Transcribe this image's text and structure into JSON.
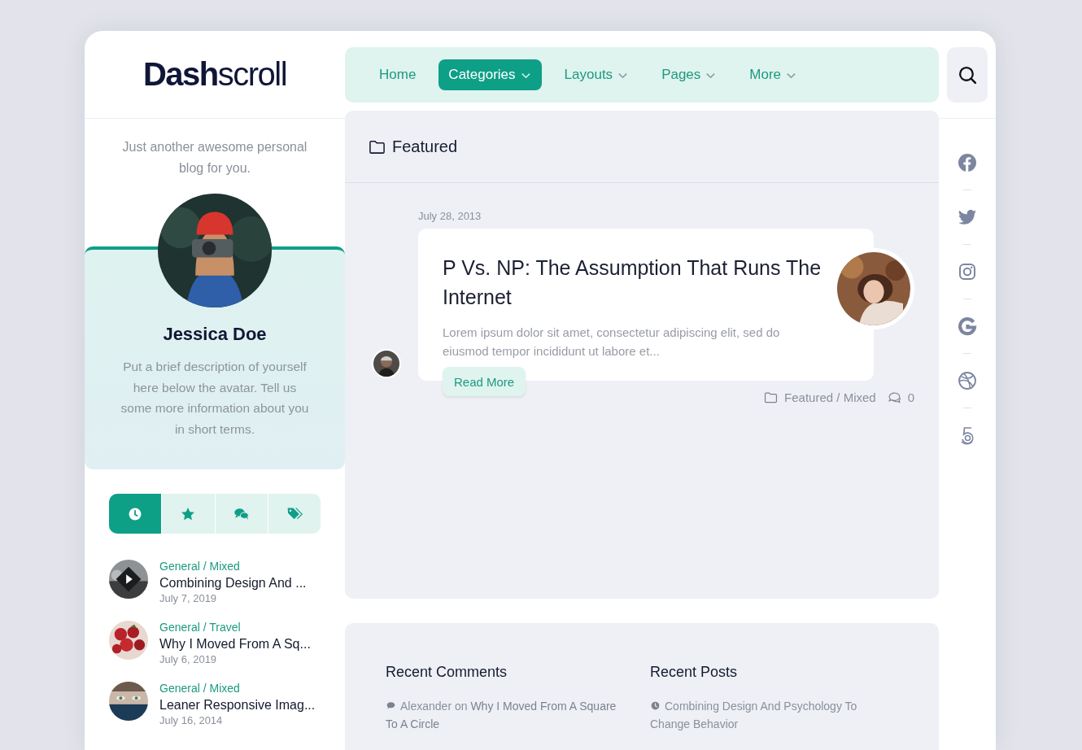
{
  "logo": "**Dash**scroll",
  "nav": {
    "items": [
      {
        "label": "Home",
        "selected": false,
        "dropdown": false
      },
      {
        "label": "Categories",
        "selected": true,
        "dropdown": true
      },
      {
        "label": "Layouts",
        "selected": false,
        "dropdown": true
      },
      {
        "label": "Pages",
        "selected": false,
        "dropdown": true
      },
      {
        "label": "More",
        "selected": false,
        "dropdown": true
      }
    ]
  },
  "sidebar": {
    "tagline": "Just another awesome personal blog for you.",
    "profile": {
      "name": "Jessica Doe",
      "bio": "Put a brief description of yourself here below the avatar. Tell us some more information about you in short terms."
    },
    "tabs": [
      {
        "kind": "clock",
        "selected": true
      },
      {
        "kind": "star",
        "selected": false
      },
      {
        "kind": "comments",
        "selected": false
      },
      {
        "kind": "tags",
        "selected": false
      }
    ],
    "posts": [
      {
        "category": "General / Mixed",
        "title": "Combining Design And ...",
        "date": "July 7, 2019"
      },
      {
        "category": "General / Travel",
        "title": "Why I Moved From A Sq...",
        "date": "July 6, 2019"
      },
      {
        "category": "General / Mixed",
        "title": "Leaner Responsive Imag...",
        "date": "July 16, 2014"
      }
    ]
  },
  "archive": {
    "title": "Featured",
    "posts": [
      {
        "date": "July 28, 2013",
        "title": "P Vs. NP: The Assumption That Runs The Internet",
        "excerpt": "Lorem ipsum dolor sit amet, consectetur adipiscing elit, sed do eiusmod tempor incididunt ut labore et...",
        "button": "Read More",
        "categories": "Featured / Mixed",
        "comments": "0"
      }
    ]
  },
  "widgets": [
    {
      "title": "Recent Comments",
      "kind": "comments",
      "items": [
        "Alexander on **Why I Moved From A Square To A Circle**"
      ]
    },
    {
      "title": "Recent Posts",
      "kind": "posts",
      "items": [
        "Combining Design And Psychology To Change Behavior"
      ]
    }
  ]
}
